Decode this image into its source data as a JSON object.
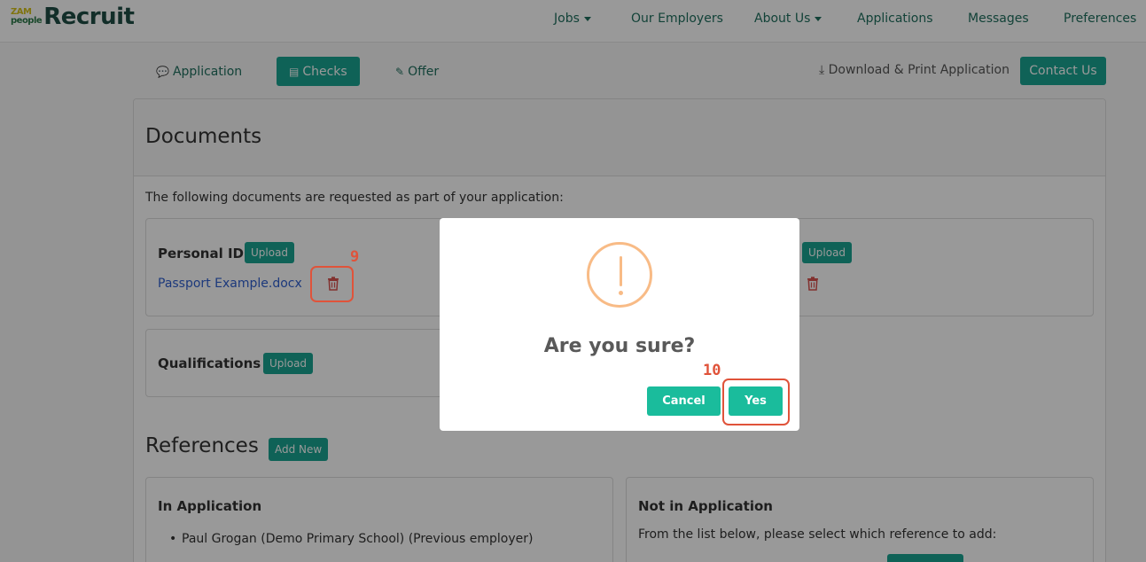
{
  "brand": {
    "mark_top": "ZAM",
    "mark_bottom": "people",
    "name": "Recruit"
  },
  "nav": {
    "jobs": "Jobs",
    "employers": "Our Employers",
    "about": "About Us",
    "applications": "Applications",
    "messages": "Messages",
    "preferences": "Preferences"
  },
  "subtabs": {
    "application": "Application",
    "checks": "Checks",
    "offer": "Offer",
    "download": "Download & Print Application",
    "contact": "Contact Us"
  },
  "documents": {
    "title": "Documents",
    "intro": "The following documents are requested as part of your application:",
    "personal_id_label": "Personal ID",
    "upload_label": "Upload",
    "personal_id_file": "Passport Example.docx",
    "qualifications_label": "Qualifications"
  },
  "references": {
    "title": "References",
    "add_new": "Add New",
    "in_application_title": "In Application",
    "in_application_items": [
      "Paul Grogan (Demo Primary School) (Previous employer)"
    ],
    "not_in_application_title": "Not in Application",
    "not_in_application_desc": "From the list below, please select which reference to add:"
  },
  "modal": {
    "title": "Are you sure?",
    "cancel": "Cancel",
    "yes": "Yes"
  },
  "annotations": {
    "delete_marker": "9",
    "yes_marker": "10"
  },
  "colors": {
    "accent": "#1aa391",
    "modal_button": "#1abc9c",
    "warning": "#f8bb86",
    "annotation": "#e0533a",
    "link": "#2f5fcf",
    "delete": "#d9534f"
  }
}
